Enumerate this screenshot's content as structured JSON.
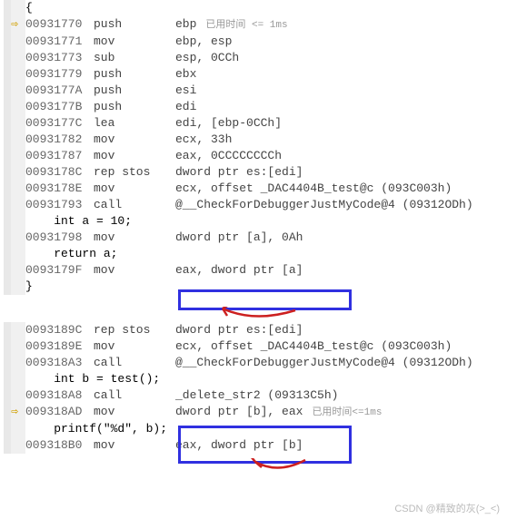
{
  "block1": {
    "lines": [
      {
        "arrow": "",
        "text": "{"
      },
      {
        "arrow": "⇨",
        "addr": "00931770",
        "mnem": "push",
        "ops": "ebp",
        "hint": "已用时间 <= 1ms"
      },
      {
        "arrow": "",
        "addr": "00931771",
        "mnem": "mov",
        "ops": "ebp, esp"
      },
      {
        "arrow": "",
        "addr": "00931773",
        "mnem": "sub",
        "ops": "esp, 0CCh"
      },
      {
        "arrow": "",
        "addr": "00931779",
        "mnem": "push",
        "ops": "ebx"
      },
      {
        "arrow": "",
        "addr": "0093177A",
        "mnem": "push",
        "ops": "esi"
      },
      {
        "arrow": "",
        "addr": "0093177B",
        "mnem": "push",
        "ops": "edi"
      },
      {
        "arrow": "",
        "addr": "0093177C",
        "mnem": "lea",
        "ops": "edi, [ebp-0CCh]"
      },
      {
        "arrow": "",
        "addr": "00931782",
        "mnem": "mov",
        "ops": "ecx, 33h"
      },
      {
        "arrow": "",
        "addr": "00931787",
        "mnem": "mov",
        "ops": "eax, 0CCCCCCCCh"
      },
      {
        "arrow": "",
        "addr": "0093178C",
        "mnem": "rep stos",
        "ops": "dword ptr es:[edi]"
      },
      {
        "arrow": "",
        "addr": "0093178E",
        "mnem": "mov",
        "ops": "ecx, offset _DAC4404B_test@c (093C003h)"
      },
      {
        "arrow": "",
        "addr": "00931793",
        "mnem": "call",
        "ops": "@__CheckForDebuggerJustMyCode@4 (09312ODh)"
      },
      {
        "arrow": "",
        "text": "    int a = 10;"
      },
      {
        "arrow": "",
        "addr": "00931798",
        "mnem": "mov",
        "ops": "dword ptr [a], 0Ah"
      },
      {
        "arrow": "",
        "text": "    return a;"
      },
      {
        "arrow": "",
        "addr": "0093179F",
        "mnem": "mov",
        "ops": "eax, dword ptr [a]"
      },
      {
        "arrow": "",
        "text": "}"
      }
    ]
  },
  "block2": {
    "lines": [
      {
        "arrow": "",
        "addr": "0093189C",
        "mnem": "rep stos",
        "ops": "dword ptr es:[edi]"
      },
      {
        "arrow": "",
        "addr": "0093189E",
        "mnem": "mov",
        "ops": "ecx, offset _DAC4404B_test@c (093C003h)"
      },
      {
        "arrow": "",
        "addr": "009318A3",
        "mnem": "call",
        "ops": "@__CheckForDebuggerJustMyCode@4 (09312ODh)"
      },
      {
        "arrow": "",
        "text": "    int b = test();"
      },
      {
        "arrow": "",
        "addr": "009318A8",
        "mnem": "call",
        "ops": "_delete_str2 (09313C5h)"
      },
      {
        "arrow": "⇨",
        "addr": "009318AD",
        "mnem": "mov",
        "ops": "dword ptr [b], eax",
        "hint": "已用时间<=1ms"
      },
      {
        "arrow": "",
        "text": "    printf(\"%d\", b);"
      },
      {
        "arrow": "",
        "addr": "009318B0",
        "mnem": "mov",
        "ops": "eax, dword ptr [b]"
      }
    ]
  },
  "watermark": "CSDN @精致的灰(>_<)"
}
